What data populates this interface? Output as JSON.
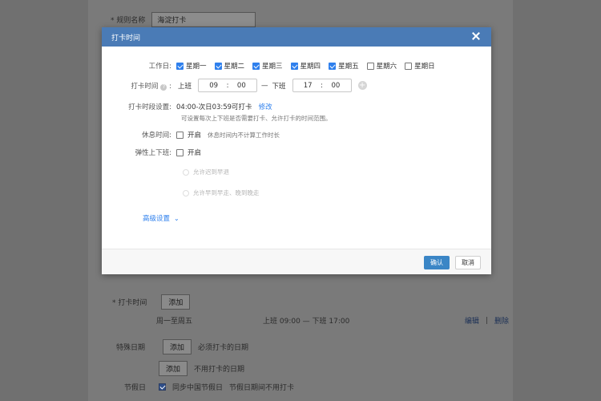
{
  "background": {
    "rule_name_label": "* 规则名称",
    "rule_name_value": "海淀打卡",
    "clock_time_label": "* 打卡时间",
    "add_label": "添加",
    "schedule_days": "周一至周五",
    "schedule_times": "上班 09:00 — 下班 17:00",
    "edit_label": "编辑",
    "delete_label": "删除",
    "special_date_label": "特殊日期",
    "must_clock_text": "必须打卡的日期",
    "no_clock_text": "不用打卡的日期",
    "holiday_label": "节假日",
    "holiday_sync_text": "同步中国节假日",
    "holiday_sync_desc": "节假日期间不用打卡"
  },
  "modal": {
    "title": "打卡时间",
    "workdays_label": "工作日:",
    "workdays": [
      {
        "label": "星期一",
        "checked": true
      },
      {
        "label": "星期二",
        "checked": true
      },
      {
        "label": "星期三",
        "checked": true
      },
      {
        "label": "星期四",
        "checked": true
      },
      {
        "label": "星期五",
        "checked": true
      },
      {
        "label": "星期六",
        "checked": false
      },
      {
        "label": "星期日",
        "checked": false
      }
    ],
    "clock_time_label": "打卡时间",
    "on_label": "上班",
    "on_hour": "09",
    "on_min": "00",
    "dash": "—",
    "off_label": "下班",
    "off_hour": "17",
    "off_min": "00",
    "segment_label": "打卡时段设置:",
    "segment_value": "04:00-次日03:59可打卡",
    "segment_modify": "修改",
    "segment_desc": "可设置每次上下班是否需要打卡、允许打卡的时间范围。",
    "rest_label": "休息时间:",
    "rest_toggle": "开启",
    "rest_desc": "休息时间内不计算工作时长",
    "flex_label": "弹性上下班:",
    "flex_toggle": "开启",
    "flex_opt1": "允许迟到早退",
    "flex_opt2": "允许早到早走、晚到晚走",
    "advanced": "高级设置",
    "confirm": "确认",
    "cancel": "取消"
  },
  "colors": {
    "header": "#4a7bb6",
    "primary": "#3b86c6",
    "checkbox": "#2f80ed"
  }
}
